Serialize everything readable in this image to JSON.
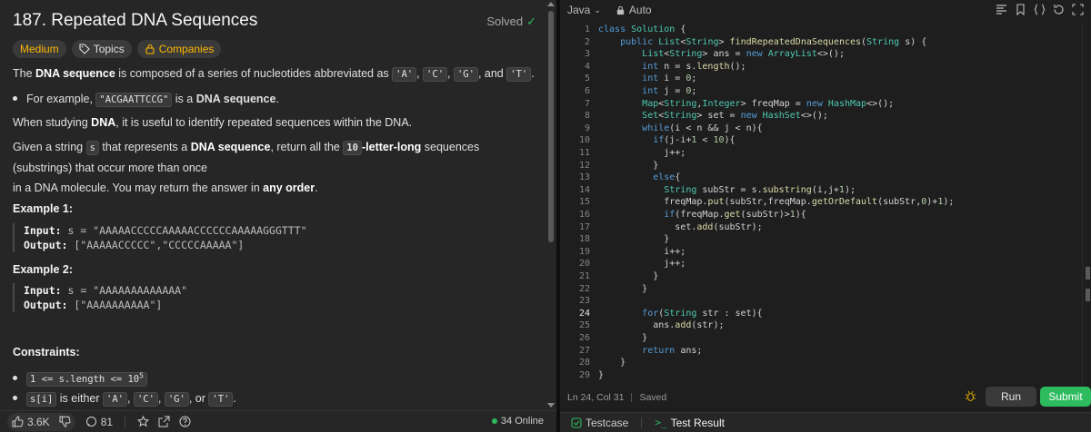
{
  "problem": {
    "title": "187. Repeated DNA Sequences",
    "status": "Solved",
    "tags": [
      "Medium",
      "Topics",
      "Companies"
    ],
    "para1_a": "The ",
    "para1_b": "DNA sequence",
    "para1_c": " is composed of a series of nucleotides abbreviated as ",
    "nuc": [
      "'A'",
      "'C'",
      "'G'",
      "'T'"
    ],
    "sep_comma": ", ",
    "sep_and": ", and ",
    "period": ".",
    "bullet1_a": "For example, ",
    "bullet1_code": "\"ACGAATTCCG\"",
    "bullet1_b": " is a ",
    "bullet1_c": "DNA sequence",
    "bullet1_d": ".",
    "para2_a": "When studying ",
    "para2_b": "DNA",
    "para2_c": ", it is useful to identify repeated sequences within the DNA.",
    "para3_a": "Given a string ",
    "para3_s": "s",
    "para3_b": " that represents a ",
    "para3_c": "DNA sequence",
    "para3_d": ", return all the ",
    "para3_e": "10",
    "para3_f": "-letter-long",
    "para3_g": " sequences (substrings) that occur more than once",
    "para3_h": "in a DNA molecule. You may return the answer in ",
    "para3_i": "any order",
    "para3_j": ".",
    "ex1_title": "Example 1:",
    "ex1_input_k": "Input:",
    "ex1_input_v": " s = \"AAAAACCCCCAAAAACCCCCCAAAAAGGGTTT\"",
    "ex1_output_k": "Output:",
    "ex1_output_v": " [\"AAAAACCCCC\",\"CCCCCAAAAA\"]",
    "ex2_title": "Example 2:",
    "ex2_input_k": "Input:",
    "ex2_input_v": " s = \"AAAAAAAAAAAAA\"",
    "ex2_output_k": "Output:",
    "ex2_output_v": " [\"AAAAAAAAAA\"]",
    "constraints_title": "Constraints:",
    "c1_code": "1 <= s.length <= 10",
    "c1_sup": "5",
    "c2_code": "s[i]",
    "c2_text": " is either ",
    "c2_or": ", or "
  },
  "footer_left": {
    "likes": "3.6K",
    "comments": "81",
    "online": "34 Online"
  },
  "editor": {
    "language": "Java",
    "mode": "Auto",
    "status_pos": "Ln 24, Col 31",
    "status_saved": "Saved",
    "run": "Run",
    "submit": "Submit",
    "tab_testcase": "Testcase",
    "tab_result": "Test Result",
    "lines": [
      "class Solution {",
      "    public List<String> findRepeatedDnaSequences(String s) {",
      "        List<String> ans = new ArrayList<>();",
      "        int n = s.length();",
      "        int i = 0;",
      "        int j = 0;",
      "        Map<String,Integer> freqMap = new HashMap<>();",
      "        Set<String> set = new HashSet<>();",
      "        while(i < n && j < n){",
      "          if(j-i+1 < 10){",
      "            j++;",
      "          }",
      "          else{",
      "            String subStr = s.substring(i,j+1);",
      "            freqMap.put(subStr,freqMap.getOrDefault(subStr,0)+1);",
      "            if(freqMap.get(subStr)>1){",
      "              set.add(subStr);",
      "            }",
      "            i++;",
      "            j++;",
      "          }",
      "        }",
      "",
      "        for(String str : set){",
      "          ans.add(str);",
      "        }",
      "        return ans;",
      "    }",
      "}"
    ]
  }
}
